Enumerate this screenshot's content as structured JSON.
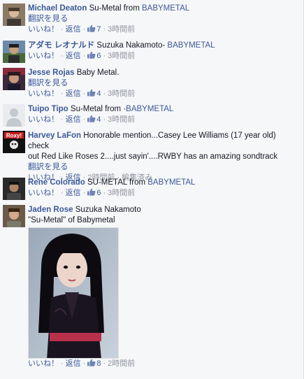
{
  "icons": {
    "like": "thumbs-up-icon"
  },
  "colors": {
    "link": "#3b5998",
    "meta": "#90949c",
    "text": "#141823"
  },
  "comments": [
    {
      "author": "Michael Deaton",
      "text_pre": "Su-Metal from ",
      "text_link": "BABYMETAL",
      "see_translation": "翻訳を見る",
      "like": "いいね！",
      "reply": "返信",
      "like_count": "7",
      "time": "3時間前"
    },
    {
      "author": "アダモ レオナルド",
      "text_pre": "Suzuka Nakamoto- ",
      "text_link": "BABYMETAL",
      "like": "いいね！",
      "reply": "返信",
      "like_count": "6",
      "time": "3時間前"
    },
    {
      "author": "Jesse Rojas",
      "text_pre": "Baby Metal.",
      "see_translation": "翻訳を見る",
      "like": "いいね！",
      "reply": "返信",
      "like_count": "4",
      "time": "3時間前"
    },
    {
      "author": "Tuipo Tipo",
      "text_pre": "Su-Metal from ·",
      "text_link": "BABYMETAL",
      "like": "いいね！",
      "reply": "返信",
      "like_count": "4",
      "time": "3時間前"
    },
    {
      "author": "Harvey LaFon",
      "text_line1": "Honorable mention...Casey Lee Williams (17 year old) check",
      "text_line2": "out Red Like Roses 2....just sayin'....RWBY has an amazing sondtrack",
      "see_translation": "翻訳を見る",
      "like": "いいね！",
      "reply": "返信",
      "time": "2時間前",
      "edited": "編集済み"
    },
    {
      "author": "Rene Colorado",
      "text_pre": "SU-METAL from ",
      "text_link": "BABYMETAL",
      "like": "いいね！",
      "reply": "返信",
      "like_count": "6",
      "time": "3時間前"
    },
    {
      "author": "Jaden Rose",
      "text_pre": "Suzuka Nakamoto",
      "text_line2": "\"Su-Metal\" of Babymetal",
      "like": "いいね！",
      "reply": "返信",
      "like_count": "8",
      "time": "2時間前"
    }
  ]
}
